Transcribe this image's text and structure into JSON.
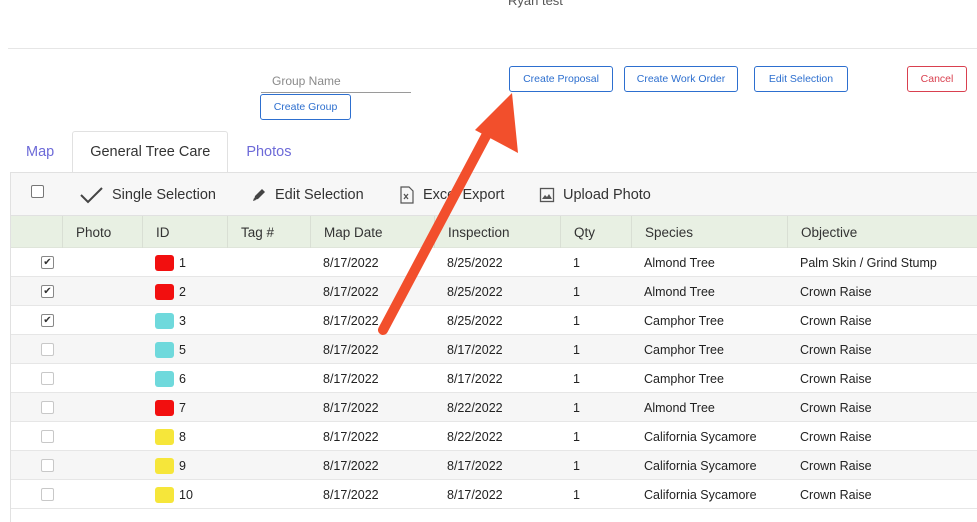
{
  "header": {
    "title": "Ryan test"
  },
  "group": {
    "name_placeholder": "Group Name",
    "create_label": "Create Group"
  },
  "actions": {
    "create_proposal": "Create Proposal",
    "create_work_order": "Create Work Order",
    "edit_selection": "Edit Selection",
    "cancel": "Cancel"
  },
  "tabs": [
    {
      "label": "Map"
    },
    {
      "label": "General Tree Care"
    },
    {
      "label": "Photos"
    }
  ],
  "toolbar": {
    "single_selection": "Single Selection",
    "edit_selection": "Edit Selection",
    "excel_export": "Excel Export",
    "upload_photo": "Upload Photo"
  },
  "columns": [
    "Photo",
    "ID",
    "Tag #",
    "Map Date",
    "Inspection",
    "Qty",
    "Species",
    "Objective"
  ],
  "colors": {
    "red": "#f20f0f",
    "cyan": "#6fd9dc",
    "yellow": "#f6e63a",
    "accent": "#2d6fcf",
    "danger": "#d9404f",
    "arrow": "#f24f2c"
  },
  "rows": [
    {
      "checked": true,
      "color": "red",
      "id": "1",
      "tag": "",
      "map_date": "8/17/2022",
      "inspection": "8/25/2022",
      "qty": "1",
      "species": "Almond Tree",
      "objective": "Palm Skin / Grind Stump"
    },
    {
      "checked": true,
      "color": "red",
      "id": "2",
      "tag": "",
      "map_date": "8/17/2022",
      "inspection": "8/25/2022",
      "qty": "1",
      "species": "Almond Tree",
      "objective": "Crown Raise"
    },
    {
      "checked": true,
      "color": "cyan",
      "id": "3",
      "tag": "",
      "map_date": "8/17/2022",
      "inspection": "8/25/2022",
      "qty": "1",
      "species": "Camphor Tree",
      "objective": "Crown Raise"
    },
    {
      "checked": false,
      "color": "cyan",
      "id": "5",
      "tag": "",
      "map_date": "8/17/2022",
      "inspection": "8/17/2022",
      "qty": "1",
      "species": "Camphor Tree",
      "objective": "Crown Raise"
    },
    {
      "checked": false,
      "color": "cyan",
      "id": "6",
      "tag": "",
      "map_date": "8/17/2022",
      "inspection": "8/17/2022",
      "qty": "1",
      "species": "Camphor Tree",
      "objective": "Crown Raise"
    },
    {
      "checked": false,
      "color": "red",
      "id": "7",
      "tag": "",
      "map_date": "8/17/2022",
      "inspection": "8/22/2022",
      "qty": "1",
      "species": "Almond Tree",
      "objective": "Crown Raise"
    },
    {
      "checked": false,
      "color": "yellow",
      "id": "8",
      "tag": "",
      "map_date": "8/17/2022",
      "inspection": "8/22/2022",
      "qty": "1",
      "species": "California Sycamore",
      "objective": "Crown Raise"
    },
    {
      "checked": false,
      "color": "yellow",
      "id": "9",
      "tag": "",
      "map_date": "8/17/2022",
      "inspection": "8/17/2022",
      "qty": "1",
      "species": "California Sycamore",
      "objective": "Crown Raise"
    },
    {
      "checked": false,
      "color": "yellow",
      "id": "10",
      "tag": "",
      "map_date": "8/17/2022",
      "inspection": "8/17/2022",
      "qty": "1",
      "species": "California Sycamore",
      "objective": "Crown Raise"
    }
  ]
}
